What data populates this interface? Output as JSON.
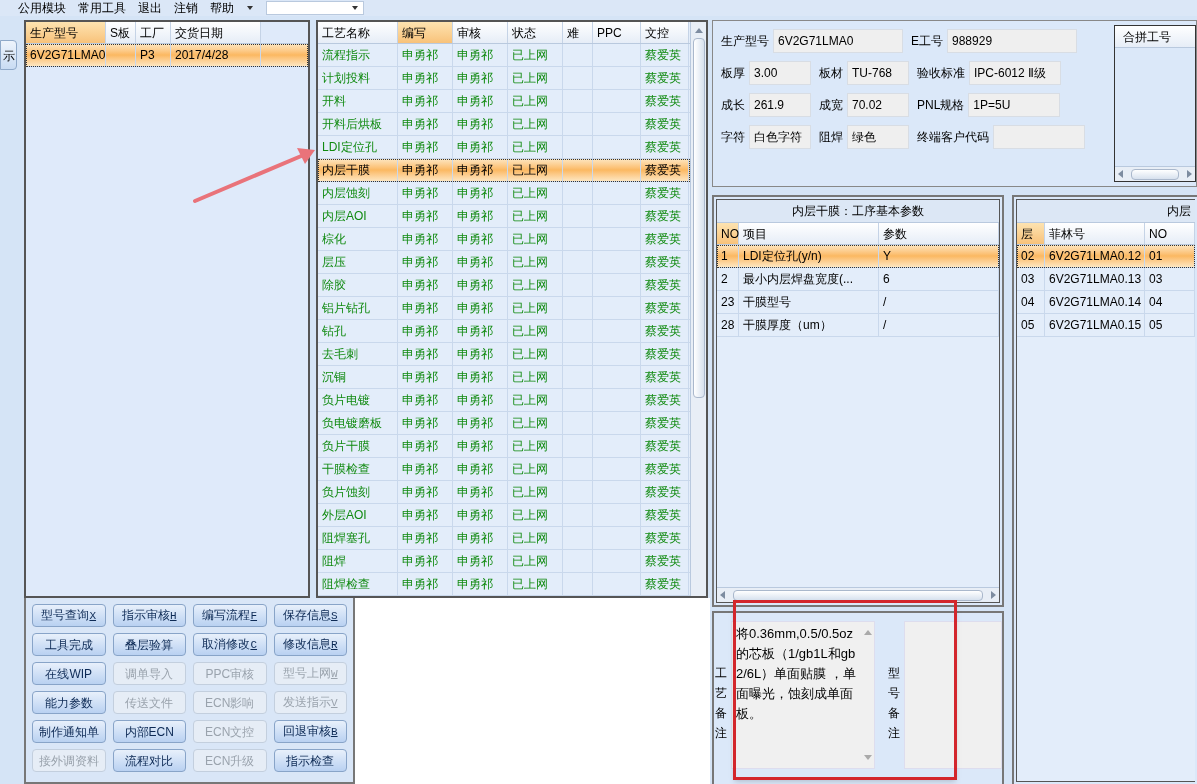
{
  "menu": [
    "公用模块",
    "常用工具",
    "退出",
    "注销",
    "帮助"
  ],
  "side_button": "示",
  "orders": {
    "columns": [
      {
        "label": "生产型号",
        "selected": true
      },
      {
        "label": "S板",
        "selected": false
      },
      {
        "label": "工厂",
        "selected": false
      },
      {
        "label": "交货日期",
        "selected": false
      }
    ],
    "rows": [
      {
        "selected": true,
        "cells": [
          "6V2G71LMA0",
          "",
          "P3",
          "2017/4/28"
        ]
      }
    ]
  },
  "process": {
    "columns": [
      {
        "label": "工艺名称",
        "selected": false
      },
      {
        "label": "编写",
        "selected": true
      },
      {
        "label": "审核",
        "selected": false
      },
      {
        "label": "状态",
        "selected": false
      },
      {
        "label": "难",
        "selected": false
      },
      {
        "label": "PPC",
        "selected": false
      },
      {
        "label": "文控",
        "selected": false
      }
    ],
    "rows": [
      {
        "selected": false,
        "cells": [
          "流程指示",
          "申勇祁",
          "申勇祁",
          "已上网",
          "",
          "",
          "蔡爱英"
        ]
      },
      {
        "selected": false,
        "cells": [
          "计划投料",
          "申勇祁",
          "申勇祁",
          "已上网",
          "",
          "",
          "蔡爱英"
        ]
      },
      {
        "selected": false,
        "cells": [
          "开料",
          "申勇祁",
          "申勇祁",
          "已上网",
          "",
          "",
          "蔡爱英"
        ]
      },
      {
        "selected": false,
        "cells": [
          "开料后烘板",
          "申勇祁",
          "申勇祁",
          "已上网",
          "",
          "",
          "蔡爱英"
        ]
      },
      {
        "selected": false,
        "cells": [
          "LDI定位孔",
          "申勇祁",
          "申勇祁",
          "已上网",
          "",
          "",
          "蔡爱英"
        ]
      },
      {
        "selected": true,
        "cells": [
          "内层干膜",
          "申勇祁",
          "申勇祁",
          "已上网",
          "",
          "",
          "蔡爱英"
        ]
      },
      {
        "selected": false,
        "cells": [
          "内层蚀刻",
          "申勇祁",
          "申勇祁",
          "已上网",
          "",
          "",
          "蔡爱英"
        ]
      },
      {
        "selected": false,
        "cells": [
          "内层AOI",
          "申勇祁",
          "申勇祁",
          "已上网",
          "",
          "",
          "蔡爱英"
        ]
      },
      {
        "selected": false,
        "cells": [
          "棕化",
          "申勇祁",
          "申勇祁",
          "已上网",
          "",
          "",
          "蔡爱英"
        ]
      },
      {
        "selected": false,
        "cells": [
          "层压",
          "申勇祁",
          "申勇祁",
          "已上网",
          "",
          "",
          "蔡爱英"
        ]
      },
      {
        "selected": false,
        "cells": [
          "除胶",
          "申勇祁",
          "申勇祁",
          "已上网",
          "",
          "",
          "蔡爱英"
        ]
      },
      {
        "selected": false,
        "cells": [
          "铝片钻孔",
          "申勇祁",
          "申勇祁",
          "已上网",
          "",
          "",
          "蔡爱英"
        ]
      },
      {
        "selected": false,
        "cells": [
          "钻孔",
          "申勇祁",
          "申勇祁",
          "已上网",
          "",
          "",
          "蔡爱英"
        ]
      },
      {
        "selected": false,
        "cells": [
          "去毛刺",
          "申勇祁",
          "申勇祁",
          "已上网",
          "",
          "",
          "蔡爱英"
        ]
      },
      {
        "selected": false,
        "cells": [
          "沉铜",
          "申勇祁",
          "申勇祁",
          "已上网",
          "",
          "",
          "蔡爱英"
        ]
      },
      {
        "selected": false,
        "cells": [
          "负片电镀",
          "申勇祁",
          "申勇祁",
          "已上网",
          "",
          "",
          "蔡爱英"
        ]
      },
      {
        "selected": false,
        "cells": [
          "负电镀磨板",
          "申勇祁",
          "申勇祁",
          "已上网",
          "",
          "",
          "蔡爱英"
        ]
      },
      {
        "selected": false,
        "cells": [
          "负片干膜",
          "申勇祁",
          "申勇祁",
          "已上网",
          "",
          "",
          "蔡爱英"
        ]
      },
      {
        "selected": false,
        "cells": [
          "干膜检查",
          "申勇祁",
          "申勇祁",
          "已上网",
          "",
          "",
          "蔡爱英"
        ]
      },
      {
        "selected": false,
        "cells": [
          "负片蚀刻",
          "申勇祁",
          "申勇祁",
          "已上网",
          "",
          "",
          "蔡爱英"
        ]
      },
      {
        "selected": false,
        "cells": [
          "外层AOI",
          "申勇祁",
          "申勇祁",
          "已上网",
          "",
          "",
          "蔡爱英"
        ]
      },
      {
        "selected": false,
        "cells": [
          "阻焊塞孔",
          "申勇祁",
          "申勇祁",
          "已上网",
          "",
          "",
          "蔡爱英"
        ]
      },
      {
        "selected": false,
        "cells": [
          "阻焊",
          "申勇祁",
          "申勇祁",
          "已上网",
          "",
          "",
          "蔡爱英"
        ]
      },
      {
        "selected": false,
        "cells": [
          "阻焊检查",
          "申勇祁",
          "申勇祁",
          "已上网",
          "",
          "",
          "蔡爱英"
        ]
      }
    ]
  },
  "buttons": [
    {
      "label": "型号查询",
      "key": "X",
      "disabled": false
    },
    {
      "label": "指示审核",
      "key": "H",
      "disabled": false
    },
    {
      "label": "编写流程",
      "key": "F",
      "disabled": false
    },
    {
      "label": "保存信息",
      "key": "S",
      "disabled": false
    },
    {
      "label": "工具完成",
      "disabled": false
    },
    {
      "label": "叠层验算",
      "disabled": false
    },
    {
      "label": "取消修改",
      "key": "C",
      "disabled": false
    },
    {
      "label": "修改信息",
      "key": "R",
      "disabled": false
    },
    {
      "label": "在线WIP",
      "disabled": false
    },
    {
      "label": "调单导入",
      "disabled": true
    },
    {
      "label": "PPC审核",
      "disabled": true
    },
    {
      "label": "型号上网",
      "key": "W",
      "disabled": true
    },
    {
      "label": "能力参数",
      "disabled": false
    },
    {
      "label": "传送文件",
      "disabled": true
    },
    {
      "label": "ECN影响",
      "disabled": true
    },
    {
      "label": "发送指示",
      "key": "V",
      "disabled": true
    },
    {
      "label": "制作通知单",
      "disabled": false
    },
    {
      "label": "内部ECN",
      "disabled": false
    },
    {
      "label": "ECN文控",
      "disabled": true
    },
    {
      "label": "回退审核",
      "key": "B",
      "disabled": false
    },
    {
      "label": "接外调资料",
      "disabled": true
    },
    {
      "label": "流程对比",
      "disabled": false
    },
    {
      "label": "ECN升级",
      "disabled": true
    },
    {
      "label": "指示检查",
      "disabled": false
    }
  ],
  "info": [
    [
      {
        "label": "生产型号",
        "value": "6V2G71LMA0"
      },
      {
        "label": "E工号",
        "value": "988929"
      }
    ],
    [
      {
        "label": "板厚",
        "value": "3.00"
      },
      {
        "label": "板材",
        "value": "TU-768"
      },
      {
        "label": "验收标准",
        "value": "IPC-6012 Ⅱ级"
      }
    ],
    [
      {
        "label": "成长",
        "value": "261.9"
      },
      {
        "label": "成宽",
        "value": "70.02"
      },
      {
        "label": "PNL规格",
        "value": "1P=5U"
      }
    ],
    [
      {
        "label": "字符",
        "value": "白色字符"
      },
      {
        "label": "阻焊",
        "value": "绿色"
      },
      {
        "label": "终端客户代码"
      }
    ]
  ],
  "merge_list": {
    "header": "合拼工号"
  },
  "params": {
    "title": "内层干膜：工序基本参数",
    "columns": [
      {
        "label": "NO",
        "selected": true
      },
      {
        "label": "项目",
        "selected": false
      },
      {
        "label": "参数",
        "selected": false
      }
    ],
    "rows": [
      {
        "selected": true,
        "cells": [
          "1",
          "LDI定位孔(y/n)",
          "Y"
        ]
      },
      {
        "selected": false,
        "cells": [
          "2",
          "最小内层焊盘宽度(...",
          "6"
        ]
      },
      {
        "selected": false,
        "cells": [
          "23",
          "干膜型号",
          "/"
        ]
      },
      {
        "selected": false,
        "cells": [
          "28",
          "干膜厚度（um）",
          "/"
        ]
      }
    ]
  },
  "films": {
    "title": "内层",
    "columns": [
      {
        "label": "层",
        "selected": true
      },
      {
        "label": "菲林号",
        "selected": false
      },
      {
        "label": "NO",
        "selected": false
      }
    ],
    "rows": [
      {
        "selected": true,
        "cells": [
          "02",
          "6V2G71LMA0.12",
          "01"
        ]
      },
      {
        "selected": false,
        "cells": [
          "03",
          "6V2G71LMA0.13",
          "03"
        ]
      },
      {
        "selected": false,
        "cells": [
          "04",
          "6V2G71LMA0.14",
          "04"
        ]
      },
      {
        "selected": false,
        "cells": [
          "05",
          "6V2G71LMA0.15",
          "05"
        ]
      }
    ]
  },
  "remarks": {
    "process_label": "工艺备注",
    "process_text": "将0.36mm,0.5/0.5oz的芯板（1/gb1L和gb2/6L）单面贴膜 ，单面曝光，蚀刻成单面板。",
    "model_label": "型号备注"
  }
}
